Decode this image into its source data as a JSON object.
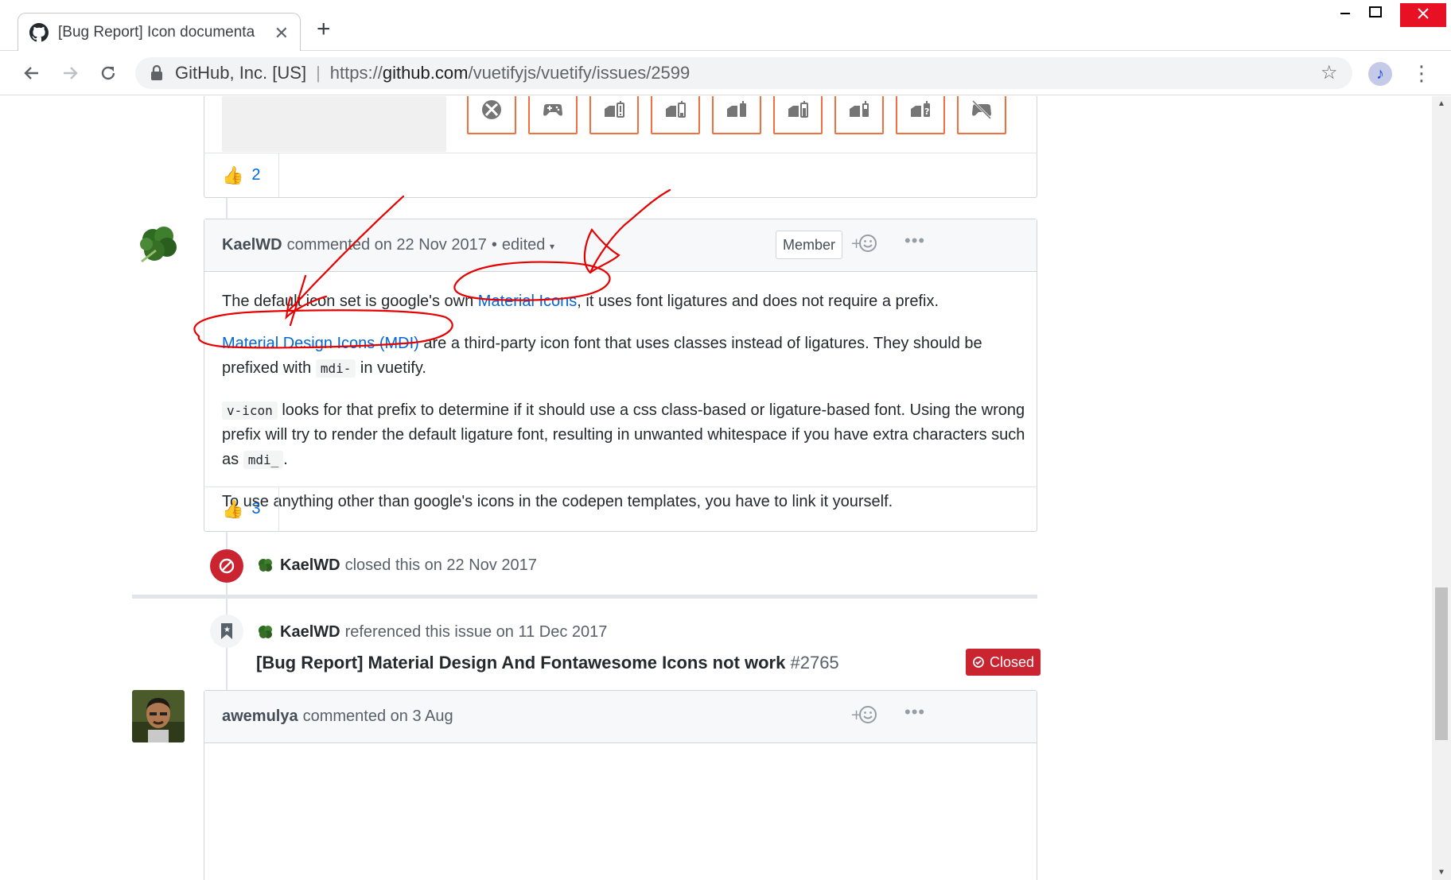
{
  "browser": {
    "tab_title": "[Bug Report] Icon documenta",
    "org": "GitHub, Inc. [US]",
    "url_scheme": "https://",
    "url_host": "github.com",
    "url_path": "/vuetifyjs/vuetify/issues/2599"
  },
  "colors": {
    "link": "#0366d6",
    "closed_red": "#cb2431",
    "annotation_red": "#e60000",
    "icon_border": "#f07040"
  },
  "icon_row": {
    "icons": [
      "xbox-icon",
      "gamepad-icon",
      "battery-alert-icon",
      "battery-low-icon",
      "battery-full-icon",
      "battery-medium-icon",
      "battery-charging-icon",
      "battery-unknown-icon",
      "gamepad-off-icon"
    ]
  },
  "reaction_1": {
    "emoji": "👍",
    "count": "2"
  },
  "comment_1": {
    "author": "KaelWD",
    "action": "commented on 22 Nov 2017",
    "bullet": "•",
    "edited": "edited",
    "badge": "Member",
    "p1_before": "The default icon set is google's own ",
    "p1_link": "Material Icons",
    "p1_after": ", it uses font ligatures and does not require a prefix.",
    "p2_link": "Material Design Icons (MDI)",
    "p2_after": " are a third-party icon font that uses classes instead of ligatures. They should be prefixed with ",
    "p2_code": "mdi-",
    "p2_end": " in vuetify.",
    "p3_code1": "v-icon",
    "p3_mid": " looks for that prefix to determine if it should use a css class-based or ligature-based font. Using the wrong prefix will try to render the default ligature font, resulting in unwanted whitespace if you have extra characters such as ",
    "p3_code2": "mdi_",
    "p3_end": ".",
    "p4": "To use anything other than google's icons in the codepen templates, you have to link it yourself."
  },
  "reaction_2": {
    "emoji": "👍",
    "count": "3"
  },
  "event_closed": {
    "author": "KaelWD",
    "text": "closed this on 22 Nov 2017"
  },
  "event_reference": {
    "author": "KaelWD",
    "text": "referenced this issue on 11 Dec 2017",
    "title": "[Bug Report] Material Design And Fontawesome Icons not work",
    "number": "#2765",
    "state": "Closed"
  },
  "comment_2": {
    "author": "awemulya",
    "action": "commented on 3 Aug"
  }
}
